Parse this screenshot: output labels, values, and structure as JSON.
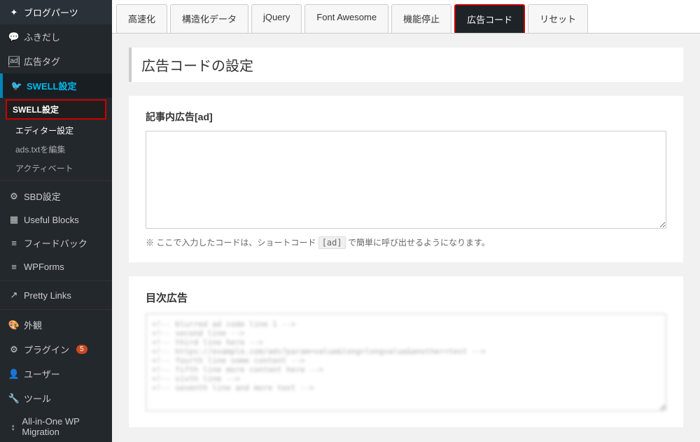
{
  "sidebar": {
    "items": [
      {
        "id": "blog-parts",
        "label": "ブログパーツ",
        "icon": "✦",
        "active": false
      },
      {
        "id": "fukidashi",
        "label": "ふきだし",
        "icon": "💬",
        "active": false
      },
      {
        "id": "ad-tag",
        "label": "広告タグ",
        "prefix": "[ad]",
        "active": false
      },
      {
        "id": "swell-settings",
        "label": "SWELL設定",
        "icon": "🐦",
        "active": true,
        "highlighted": true
      },
      {
        "id": "swell-settings-sub",
        "label": "SWELL設定",
        "sub": true,
        "boxed": true
      },
      {
        "id": "editor-settings",
        "label": "エディター設定",
        "sub": true
      },
      {
        "id": "ads-txt",
        "label": "ads.txtを編集",
        "sub": true
      },
      {
        "id": "activate",
        "label": "アクティベート",
        "sub": true
      },
      {
        "id": "sbd-settings",
        "label": "SBD設定",
        "icon": "⚙",
        "active": false
      },
      {
        "id": "useful-blocks",
        "label": "Useful Blocks",
        "icon": "▦",
        "active": false
      },
      {
        "id": "feedback",
        "label": "フィードバック",
        "icon": "≡",
        "active": false
      },
      {
        "id": "wpforms",
        "label": "WPForms",
        "icon": "≡",
        "active": false
      },
      {
        "id": "pretty-links",
        "label": "Pretty Links",
        "icon": "↗",
        "active": false
      },
      {
        "id": "appearance",
        "label": "外観",
        "icon": "🎨",
        "active": false
      },
      {
        "id": "plugins",
        "label": "プラグイン",
        "icon": "⚙",
        "badge": "5",
        "active": false
      },
      {
        "id": "users",
        "label": "ユーザー",
        "icon": "👤",
        "active": false
      },
      {
        "id": "tools",
        "label": "ツール",
        "icon": "🔧",
        "active": false
      },
      {
        "id": "allinone-wp",
        "label": "All-in-One WP Migration",
        "icon": "↕",
        "active": false
      }
    ]
  },
  "tabs": [
    {
      "id": "koukasoku",
      "label": "高速化",
      "active": false
    },
    {
      "id": "structured-data",
      "label": "構造化データ",
      "active": false
    },
    {
      "id": "jquery",
      "label": "jQuery",
      "active": false
    },
    {
      "id": "font-awesome",
      "label": "Font Awesome",
      "active": false
    },
    {
      "id": "kinou-teishi",
      "label": "機能停止",
      "active": false
    },
    {
      "id": "ad-code",
      "label": "広告コード",
      "active": true
    },
    {
      "id": "reset",
      "label": "リセット",
      "active": false
    }
  ],
  "page": {
    "title": "広告コードの設定",
    "section1": {
      "label": "記事内広告[ad]",
      "textarea_placeholder": "",
      "note": "※ ここで入力したコードは、ショートコード",
      "note_code": "[ad]",
      "note_suffix": "で簡単に呼び出せるようになります。"
    },
    "section2": {
      "label": "目次広告",
      "textarea_content": "<!-- blurred content line 1 -->\n<!-- line 2 -->\n<!-- line 3 -->\n<!-- line 4 long content here representing blurred ad code -->\n<!-- line 5 -->\n<!-- line 6 -->\n<!-- line 7 -->"
    }
  }
}
